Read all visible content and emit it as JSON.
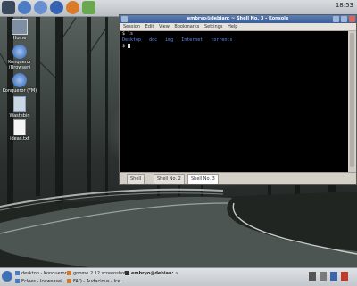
{
  "top_panel": {
    "clock": "18:53"
  },
  "desktop_icons": [
    {
      "label": "Home",
      "icon": "home-folder-icon"
    },
    {
      "label": "Konqueror (Browser)",
      "icon": "konqueror-icon"
    },
    {
      "label": "Konqueror (FM)",
      "icon": "konqueror-icon"
    },
    {
      "label": "Wastebin",
      "icon": "trash-icon"
    },
    {
      "label": "ideas.txt",
      "icon": "text-file-icon"
    }
  ],
  "konsole": {
    "title": "embryo@debian: ~ Shell No. 3 - Konsole",
    "menu": [
      "Session",
      "Edit",
      "View",
      "Bookmarks",
      "Settings",
      "Help"
    ],
    "lines": {
      "cmd1": "$ ls",
      "dirs": "Desktop   doc   img   Internet   torrents",
      "prompt": "$ "
    },
    "tabs": [
      "Shell",
      "Shell No. 2",
      "Shell No. 3"
    ]
  },
  "taskbar": {
    "row1": [
      "desktop - Konqueror",
      "gnome 2.12 screenshot...",
      "embryo@debian: ~"
    ],
    "row2": [
      "Ecloes - Iceweasel",
      "FAQ - Audacious - Ice..."
    ]
  },
  "colors": {
    "title_bar": "#3b5f97",
    "terminal_bg": "#000000",
    "dir_color": "#5a8ff0"
  }
}
